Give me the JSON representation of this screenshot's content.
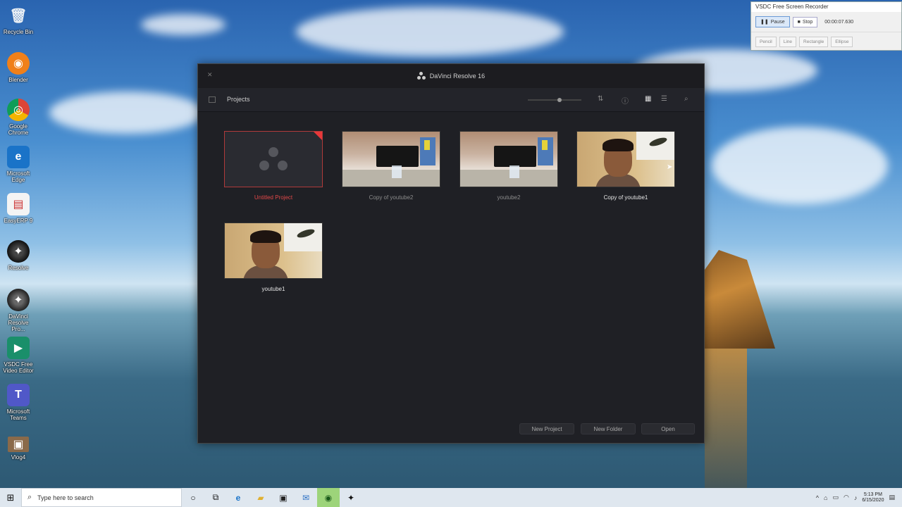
{
  "desktop": {
    "icons": [
      {
        "label": "Recycle Bin",
        "glyph": "🗑"
      },
      {
        "label": "Blender",
        "glyph": "◉"
      },
      {
        "label": "Google Chrome",
        "glyph": "◎"
      },
      {
        "label": "Microsoft Edge",
        "glyph": "e"
      },
      {
        "label": "EasyERP 9",
        "glyph": "▤"
      },
      {
        "label": "Resolve",
        "glyph": "✦"
      },
      {
        "label": "DaVinci Resolve Pro...",
        "glyph": "✦"
      },
      {
        "label": "VSDC Free Video Editor",
        "glyph": "▶"
      },
      {
        "label": "Microsoft Teams",
        "glyph": "T"
      },
      {
        "label": "Vlog4",
        "glyph": "▣"
      }
    ]
  },
  "recorder": {
    "title": "VSDC Free Screen Recorder",
    "pause_label": "Pause",
    "stop_label": "Stop",
    "elapsed": "00:00:07.630",
    "tools": [
      "Pencil",
      "Line",
      "Rectangle",
      "Ellipse"
    ]
  },
  "resolve": {
    "title": "DaVinci Resolve 16",
    "breadcrumb": "Projects",
    "projects": [
      {
        "name": "Untitled Project",
        "thumb": "empty",
        "state": "current"
      },
      {
        "name": "Copy of youtube2",
        "thumb": "lab",
        "state": "normal"
      },
      {
        "name": "youtube2",
        "thumb": "lab",
        "state": "normal"
      },
      {
        "name": "Copy of youtube1",
        "thumb": "face",
        "state": "hover"
      },
      {
        "name": "youtube1",
        "thumb": "face",
        "state": "normal"
      }
    ],
    "buttons": {
      "new_project": "New Project",
      "new_folder": "New Folder",
      "open": "Open"
    }
  },
  "taskbar": {
    "search_placeholder": "Type here to search",
    "time": "5:13 PM",
    "date": "6/15/2020"
  },
  "colors": {
    "accent_current": "#e04848",
    "window_bg": "#1f2025"
  }
}
